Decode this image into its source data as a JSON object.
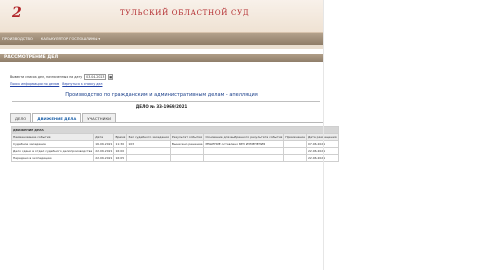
{
  "header": {
    "emblem_text": "2",
    "court_name": "ТУЛЬСКИЙ ОБЛАСТНОЙ СУД"
  },
  "top_menu": {
    "items": [
      "ПРОИЗВОДСТВО",
      "КАЛЬКУЛЯТОР ГОСПОШЛИНЫ"
    ]
  },
  "section": {
    "title": "РАССМОТРЕНИЕ ДЕЛ"
  },
  "filter": {
    "label": "Вывести список дел, назначенных на дату",
    "date_value": "03.04.2023"
  },
  "links": {
    "alphabet": "Поиск информации по делам",
    "back": "Вернуться к списку дел"
  },
  "case": {
    "title": "Производство по гражданским и административным делам - апелляция",
    "number": "ДЕЛО № 33-1969/2021"
  },
  "tabs": [
    {
      "label": "ДЕЛО",
      "active": false
    },
    {
      "label": "ДВИЖЕНИЕ ДЕЛА",
      "active": true
    },
    {
      "label": "УЧАСТНИКИ",
      "active": false
    }
  ],
  "movement_table": {
    "caption": "ДВИЖЕНИЕ ДЕЛА",
    "columns": [
      "Наименование события",
      "Дата",
      "Время",
      "Зал судебного заседания",
      "Результат события",
      "Основание для выбранного результата события",
      "Примечание",
      "Дата размещения"
    ],
    "rows": [
      [
        "Судебное заседание",
        "16.06.2021",
        "11:30",
        "103",
        "Вынесено решение",
        "РЕШЕНИЕ оставлено БЕЗ ИЗМЕНЕНИЯ",
        "",
        "07.06.2021"
      ],
      [
        "Дело сдано в отдел судебного делопроизводства",
        "22.06.2021",
        "16:00",
        "",
        "",
        "",
        "",
        "22.06.2021"
      ],
      [
        "Передано в экспедицию",
        "22.06.2021",
        "16:05",
        "",
        "",
        "",
        "",
        "22.06.2021"
      ]
    ]
  }
}
